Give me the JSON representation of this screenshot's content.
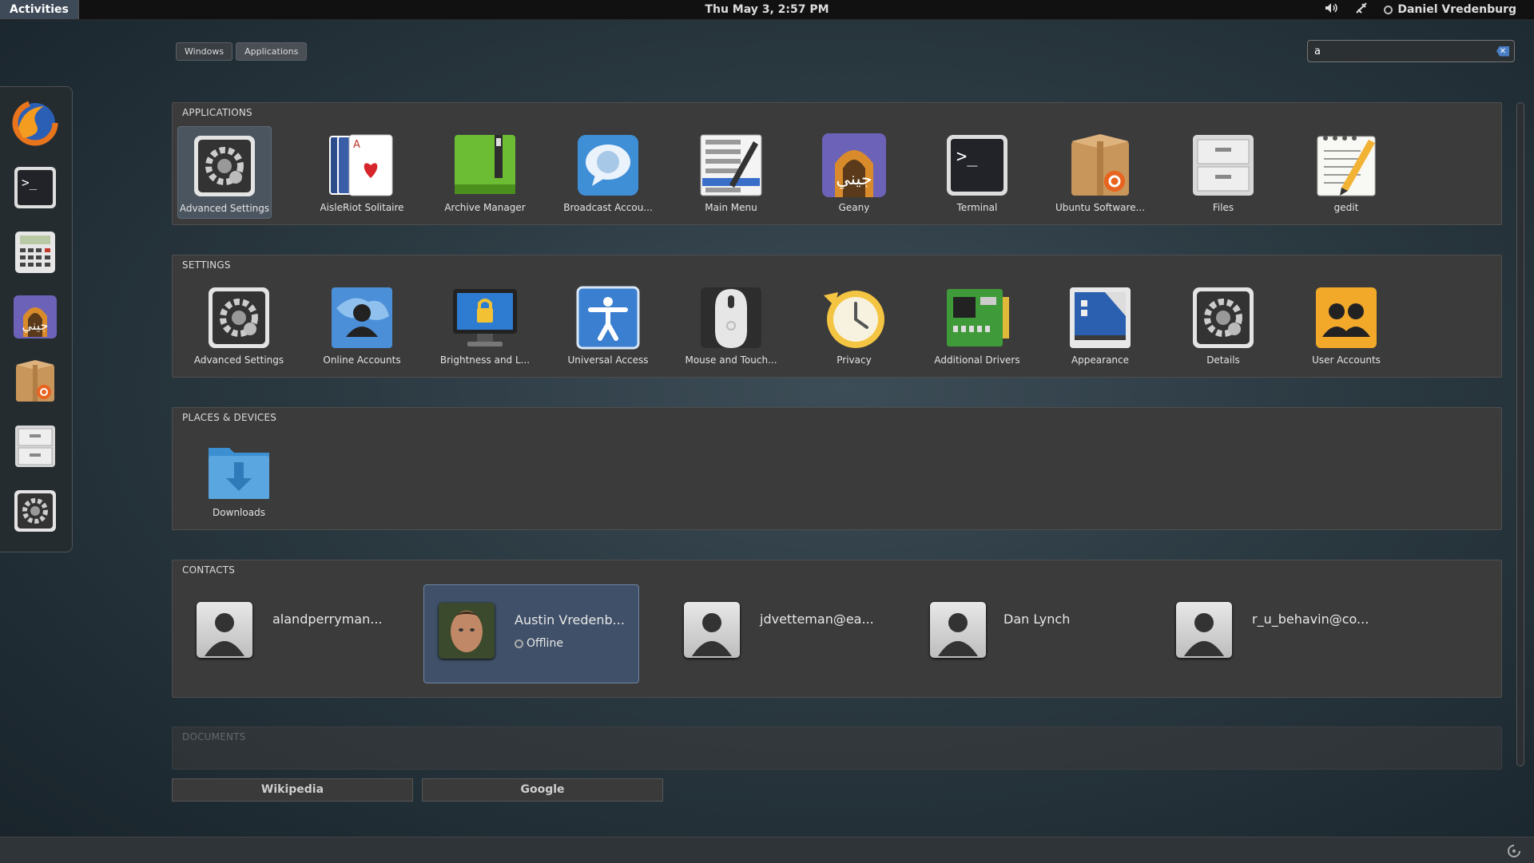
{
  "topbar": {
    "activities": "Activities",
    "clock": "Thu May  3,  2:57 PM",
    "user": "Daniel Vredenburg"
  },
  "view_tabs": [
    "Windows",
    "Applications"
  ],
  "search": {
    "value": "a"
  },
  "sections": {
    "applications": {
      "title": "APPLICATIONS",
      "items": [
        "Advanced Settings",
        "AisleRiot Solitaire",
        "Archive Manager",
        "Broadcast Accou...",
        "Main Menu",
        "Geany",
        "Terminal",
        "Ubuntu Software...",
        "Files",
        "gedit"
      ]
    },
    "settings": {
      "title": "SETTINGS",
      "items": [
        "Advanced Settings",
        "Online Accounts",
        "Brightness and L...",
        "Universal Access",
        "Mouse and Touch...",
        "Privacy",
        "Additional Drivers",
        "Appearance",
        "Details",
        "User Accounts"
      ]
    },
    "places": {
      "title": "PLACES & DEVICES",
      "items": [
        "Downloads"
      ]
    },
    "contacts": {
      "title": "CONTACTS",
      "items": [
        {
          "name": "alandperryman...",
          "status": ""
        },
        {
          "name": "Austin Vredenb...",
          "status": "Offline"
        },
        {
          "name": "jdvetteman@ea...",
          "status": ""
        },
        {
          "name": "Dan Lynch",
          "status": ""
        },
        {
          "name": "r_u_behavin@co...",
          "status": ""
        }
      ]
    },
    "documents": {
      "title": "DOCUMENTS"
    }
  },
  "providers": [
    "Wikipedia",
    "Google"
  ],
  "dash_icons": [
    "firefox-icon",
    "terminal-icon",
    "calculator-icon",
    "geany-icon",
    "software-center-icon",
    "files-icon",
    "settings-icon"
  ],
  "colors": {
    "selection": "#3f5068",
    "panel": "#111111"
  }
}
